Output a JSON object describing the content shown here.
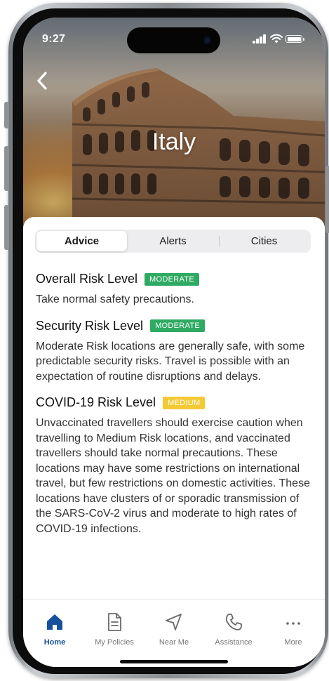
{
  "status": {
    "time": "9:27"
  },
  "header": {
    "title": "Italy"
  },
  "tabs": [
    {
      "label": "Advice",
      "active": true
    },
    {
      "label": "Alerts",
      "active": false
    },
    {
      "label": "Cities",
      "active": false
    }
  ],
  "risks": [
    {
      "title": "Overall Risk Level",
      "badge": "MODERATE",
      "badge_color": "#2eaa62",
      "description": "Take normal safety precautions."
    },
    {
      "title": "Security Risk Level",
      "badge": "MODERATE",
      "badge_color": "#2eaa62",
      "description": "Moderate Risk locations are generally safe, with some predictable security risks. Travel is possible with an expectation of routine disruptions and delays."
    },
    {
      "title": "COVID-19 Risk Level",
      "badge": "MEDIUM",
      "badge_color": "#f3c934",
      "description": "Unvaccinated travellers should exercise caution when travelling to Medium Risk locations, and vaccinated travellers should take normal precautions. These locations may have some restrictions on international travel, but few restrictions on domestic activities. These locations have clusters of or sporadic transmission of the SARS-CoV-2 virus and moderate to high rates of COVID-19 infections."
    }
  ],
  "nav": [
    {
      "label": "Home",
      "icon": "home-icon",
      "active": true
    },
    {
      "label": "My Policies",
      "icon": "document-icon",
      "active": false
    },
    {
      "label": "Near Me",
      "icon": "navigation-arrow-icon",
      "active": false
    },
    {
      "label": "Assistance",
      "icon": "phone-icon",
      "active": false
    },
    {
      "label": "More",
      "icon": "more-dots-icon",
      "active": false
    }
  ],
  "colors": {
    "accent": "#17509c",
    "moderate": "#2eaa62",
    "medium": "#f3c934"
  }
}
